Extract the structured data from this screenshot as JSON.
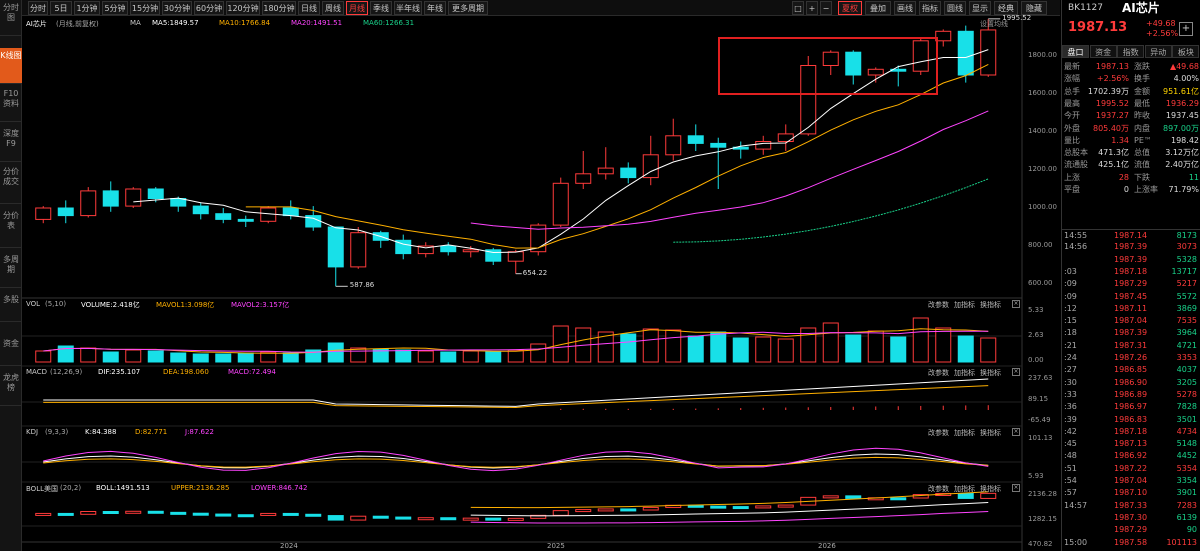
{
  "left_tabs": [
    "分时图",
    "K线图",
    "F10资料",
    "深度F9",
    "分价成交",
    "分价表",
    "多周期",
    "多股",
    "资金",
    "龙虎榜"
  ],
  "periods": [
    "分时",
    "5日",
    "1分钟",
    "5分钟",
    "15分钟",
    "30分钟",
    "60分钟",
    "120分钟",
    "180分钟",
    "日线",
    "周线",
    "月线",
    "季线",
    "半年线",
    "年线",
    "更多周期"
  ],
  "active_period": "月线",
  "right_tools": [
    "夏权",
    "叠加",
    "画线",
    "指标",
    "圆线",
    "显示",
    "经典",
    "隐藏"
  ],
  "right_tool_icons": [
    "square-icon",
    "plus-icon",
    "minus-icon"
  ],
  "chart": {
    "title": "AI芯片",
    "adj": "(月线,前复权)",
    "ma_legend": [
      {
        "t": "MA",
        "c": "#c8c8c8"
      },
      {
        "t": "MA5:1849.57",
        "c": "#ffffff"
      },
      {
        "t": "MA10:1766.84",
        "c": "#ffb000"
      },
      {
        "t": "MA20:1491.51",
        "c": "#ff44ff"
      },
      {
        "t": "MA60:1266.31",
        "c": "#19d28a"
      }
    ],
    "settings_label": "设置均线",
    "y_labels": [
      "1800.00",
      "1600.00",
      "1400.00",
      "1200.00",
      "1000.00",
      "800.00",
      "600.00"
    ],
    "high_label": "1995.52",
    "low_label1": "587.86",
    "low_label2": "654.22",
    "x_labels": [
      "2024",
      "2025",
      "2026"
    ]
  },
  "chart_data": {
    "type": "candlestick",
    "candles": [
      [
        940,
        1000,
        920,
        1010
      ],
      [
        1000,
        960,
        920,
        1040
      ],
      [
        960,
        1090,
        950,
        1110
      ],
      [
        1090,
        1010,
        980,
        1140
      ],
      [
        1010,
        1100,
        1000,
        1110
      ],
      [
        1100,
        1050,
        1030,
        1110
      ],
      [
        1050,
        1010,
        980,
        1060
      ],
      [
        1010,
        970,
        940,
        1030
      ],
      [
        970,
        940,
        920,
        1000
      ],
      [
        940,
        930,
        900,
        960
      ],
      [
        930,
        1000,
        920,
        1010
      ],
      [
        1000,
        960,
        940,
        1040
      ],
      [
        960,
        900,
        880,
        1010
      ],
      [
        900,
        690,
        587.86,
        900
      ],
      [
        690,
        870,
        680,
        900
      ],
      [
        870,
        830,
        790,
        880
      ],
      [
        830,
        760,
        730,
        860
      ],
      [
        760,
        800,
        740,
        820
      ],
      [
        800,
        770,
        750,
        820
      ],
      [
        770,
        780,
        740,
        800
      ],
      [
        780,
        720,
        700,
        790
      ],
      [
        720,
        770,
        654.22,
        780
      ],
      [
        770,
        910,
        750,
        920
      ],
      [
        910,
        1130,
        900,
        1160
      ],
      [
        1130,
        1180,
        1100,
        1300
      ],
      [
        1180,
        1210,
        1150,
        1320
      ],
      [
        1210,
        1160,
        1130,
        1240
      ],
      [
        1160,
        1280,
        1120,
        1380
      ],
      [
        1280,
        1380,
        1250,
        1470
      ],
      [
        1380,
        1340,
        1300,
        1440
      ],
      [
        1340,
        1320,
        1100,
        1370
      ],
      [
        1320,
        1310,
        1260,
        1350
      ],
      [
        1310,
        1350,
        1280,
        1380
      ],
      [
        1350,
        1390,
        1300,
        1440
      ],
      [
        1390,
        1750,
        1380,
        1800
      ],
      [
        1750,
        1820,
        1700,
        1830
      ],
      [
        1820,
        1700,
        1650,
        1830
      ],
      [
        1700,
        1730,
        1660,
        1740
      ],
      [
        1730,
        1720,
        1640,
        1750
      ],
      [
        1720,
        1880,
        1700,
        1890
      ],
      [
        1880,
        1930,
        1850,
        1940
      ],
      [
        1930,
        1700,
        1660,
        1960
      ],
      [
        1700,
        1937.13,
        1690,
        1995.52
      ]
    ],
    "ma_series": [
      {
        "name": "MA5",
        "color": "#ffffff"
      },
      {
        "name": "MA10",
        "color": "#ffb000"
      },
      {
        "name": "MA20",
        "color": "#ff44ff"
      },
      {
        "name": "MA60",
        "color": "#19d28a"
      }
    ],
    "ylim": [
      600,
      1800
    ]
  },
  "sub_panels": [
    {
      "name": "VOL",
      "params": "(5,10)",
      "items": [
        {
          "t": "VOLUME:2.418亿",
          "c": "#ffffff"
        },
        {
          "t": "MAVOL1:3.098亿",
          "c": "#ffb000"
        },
        {
          "t": "MAVOL2:3.157亿",
          "c": "#ff44ff"
        }
      ],
      "scale": [
        "5.33",
        "2.63",
        "0.00"
      ]
    },
    {
      "name": "MACD",
      "params": "(12,26,9)",
      "items": [
        {
          "t": "DIF:235.107",
          "c": "#ffffff"
        },
        {
          "t": "DEA:198.060",
          "c": "#ffb000"
        },
        {
          "t": "MACD:72.494",
          "c": "#ff44ff"
        }
      ],
      "scale": [
        "237.63",
        "89.15",
        "-65.49"
      ]
    },
    {
      "name": "KDJ",
      "params": "(9,3,3)",
      "items": [
        {
          "t": "K:84.388",
          "c": "#ffffff"
        },
        {
          "t": "D:82.771",
          "c": "#ffb000"
        },
        {
          "t": "J:87.622",
          "c": "#ff44ff"
        }
      ],
      "scale": [
        "101.13",
        "5.93"
      ]
    },
    {
      "name": "BOLL美国",
      "params": "(20,2)",
      "items": [
        {
          "t": "BOLL:1491.513",
          "c": "#ffffff"
        },
        {
          "t": "UPPER:2136.285",
          "c": "#ffb000"
        },
        {
          "t": "LOWER:846.742",
          "c": "#ff44ff"
        }
      ],
      "scale": [
        "2136.28",
        "1282.15",
        "470.82"
      ]
    }
  ],
  "panel_actions": [
    "改参数",
    "加指标",
    "换指标"
  ],
  "quote": {
    "code": "BK1127",
    "name": "AI芯片",
    "price": "1987.13",
    "change": "+49.68",
    "pct": "+2.56%",
    "tabs": [
      "盘口",
      "资金",
      "指数",
      "异动",
      "板块"
    ],
    "rows": [
      [
        "最新",
        "1987.13",
        "涨跌",
        "▲49.68"
      ],
      [
        "涨幅",
        "+2.56%",
        "换手",
        "4.00%"
      ],
      [
        "总手",
        "1702.39万",
        "金额",
        "951.61亿"
      ],
      [
        "最高",
        "1995.52",
        "最低",
        "1936.29"
      ],
      [
        "今开",
        "1937.27",
        "昨收",
        "1937.45"
      ],
      [
        "外盘",
        "805.40万",
        "内盘",
        "897.00万"
      ],
      [
        "量比",
        "1.34",
        "PE™",
        "198.42"
      ],
      [
        "总股本",
        "471.3亿",
        "总值",
        "3.12万亿"
      ],
      [
        "流通股",
        "425.1亿",
        "流值",
        "2.40万亿"
      ],
      [
        "上涨",
        "28",
        "下跌",
        "11"
      ],
      [
        "平盘",
        "0",
        "上涨率",
        "71.79%"
      ]
    ],
    "ticks": [
      [
        "14:55",
        "1987.14",
        "8173"
      ],
      [
        "14:56",
        "1987.39",
        "3073"
      ],
      [
        "",
        "1987.39",
        "5328"
      ],
      [
        ":03",
        "1987.18",
        "13717"
      ],
      [
        ":09",
        "1987.29",
        "5217"
      ],
      [
        ":09",
        "1987.45",
        "5572"
      ],
      [
        ":12",
        "1987.11",
        "3869"
      ],
      [
        ":15",
        "1987.04",
        "7535"
      ],
      [
        ":18",
        "1987.39",
        "3964"
      ],
      [
        ":21",
        "1987.31",
        "4721"
      ],
      [
        ":24",
        "1987.26",
        "3353"
      ],
      [
        ":27",
        "1986.85",
        "4037"
      ],
      [
        ":30",
        "1986.90",
        "3205"
      ],
      [
        ":33",
        "1986.89",
        "5278"
      ],
      [
        ":36",
        "1986.97",
        "7828"
      ],
      [
        ":39",
        "1986.83",
        "3501"
      ],
      [
        ":42",
        "1987.18",
        "4734"
      ],
      [
        ":45",
        "1987.13",
        "5148"
      ],
      [
        ":48",
        "1986.92",
        "4452"
      ],
      [
        ":51",
        "1987.22",
        "5354"
      ],
      [
        ":54",
        "1987.04",
        "3354"
      ],
      [
        ":57",
        "1987.10",
        "3901"
      ],
      [
        "14:57",
        "1987.33",
        "7283"
      ],
      [
        "",
        "1987.30",
        "6139"
      ],
      [
        "",
        "1987.29",
        "90"
      ],
      [
        "15:00",
        "1987.58",
        "101113"
      ]
    ]
  }
}
